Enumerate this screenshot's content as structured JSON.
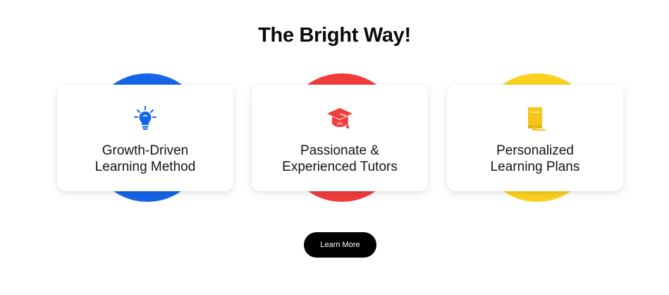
{
  "section": {
    "title": "The Bright Way!"
  },
  "features": [
    {
      "line1": "Growth-Driven",
      "line2": "Learning Method",
      "icon": "lightbulb-icon",
      "accent": "#1565e6"
    },
    {
      "line1": "Passionate &",
      "line2": "Experienced Tutors",
      "icon": "graduation-cap-icon",
      "accent": "#f23c3c"
    },
    {
      "line1": "Personalized",
      "line2": "Learning Plans",
      "icon": "book-icon",
      "accent": "#fcd21f"
    }
  ],
  "cta": {
    "label": "Learn More"
  }
}
